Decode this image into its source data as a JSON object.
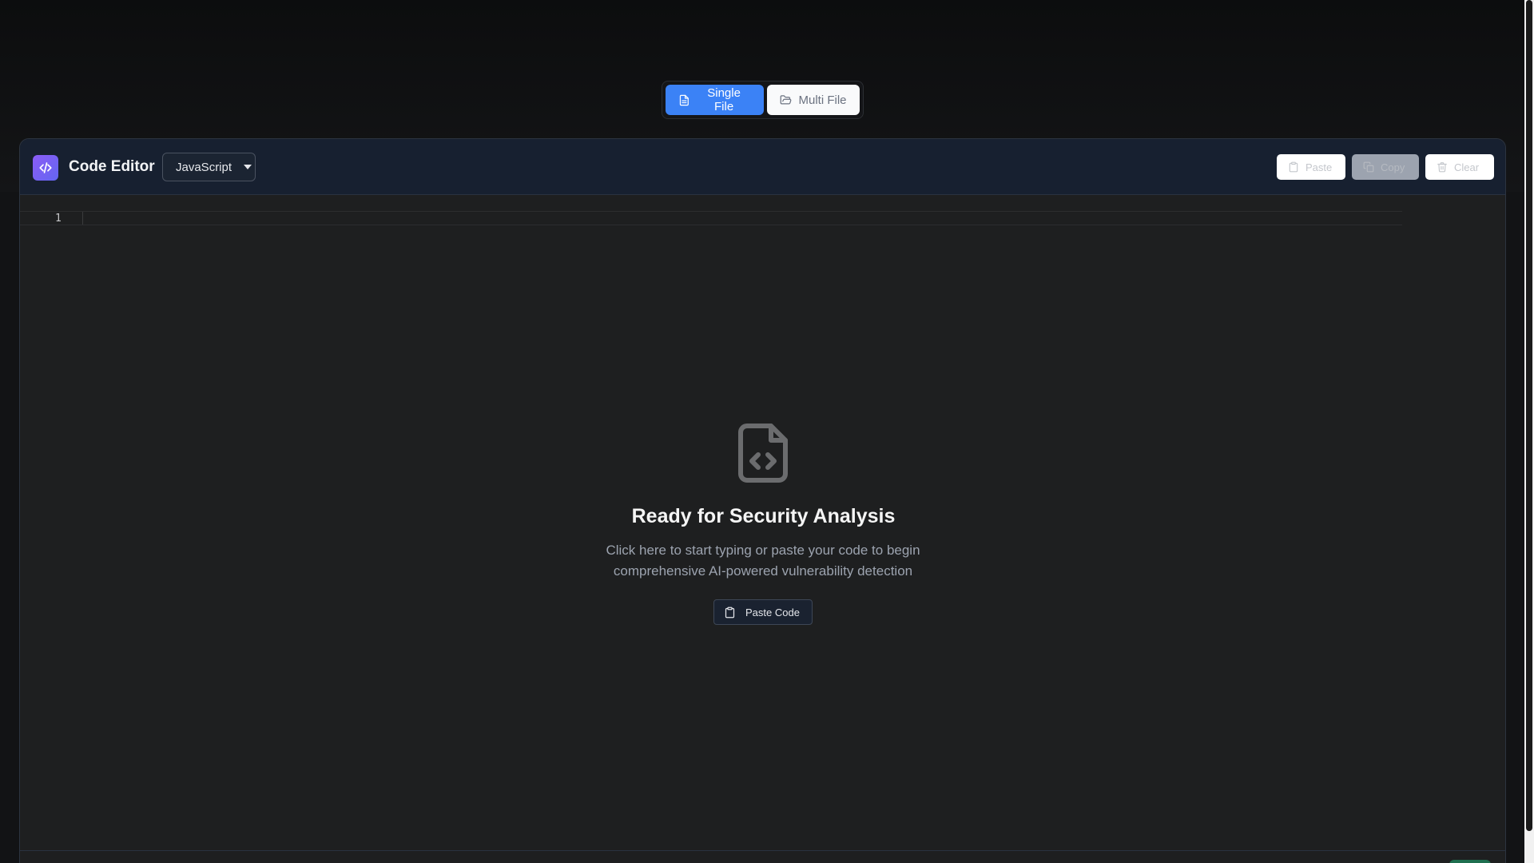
{
  "mode_toggle": {
    "single_file_label": "Single File",
    "multi_file_label": "Multi File",
    "active": "Single File"
  },
  "editor": {
    "title": "Code Editor",
    "language": "JavaScript",
    "paste_label": "Paste",
    "copy_label": "Copy",
    "clear_label": "Clear",
    "line_number": "1"
  },
  "empty_state": {
    "title": "Ready for Security Analysis",
    "description": "Click here to start typing or paste your code to begin comprehensive AI-powered vulnerability detection",
    "paste_code_label": "Paste Code"
  },
  "colors": {
    "accent": "#3b82f6",
    "logo_gradient_start": "#8b5cf6",
    "logo_gradient_end": "#6366f1",
    "background": "#121315",
    "panel": "#1e1f20"
  },
  "icons": {
    "single_file": "file-text-icon",
    "multi_file": "folder-open-icon",
    "logo": "code-icon",
    "paste": "clipboard-icon",
    "copy": "copy-icon",
    "clear": "trash-icon",
    "empty": "file-code-icon"
  }
}
